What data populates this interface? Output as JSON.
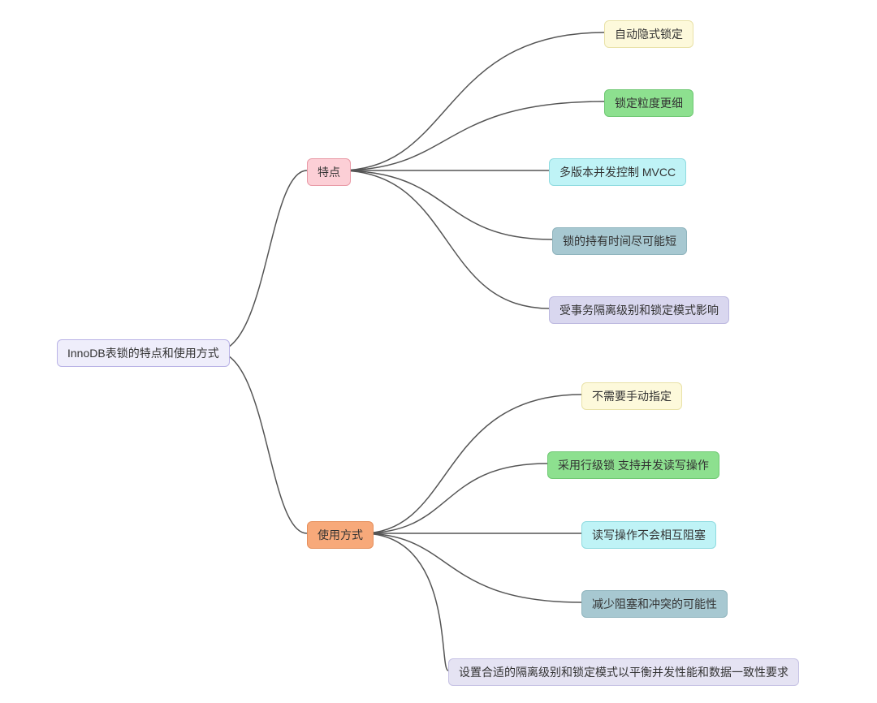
{
  "root": {
    "label": "InnoDB表锁的特点和使用方式"
  },
  "branches": [
    {
      "key": "features",
      "label": "特点",
      "leaves": [
        {
          "label": "自动隐式锁定"
        },
        {
          "label": "锁定粒度更细"
        },
        {
          "label": "多版本并发控制 MVCC"
        },
        {
          "label": "锁的持有时间尽可能短"
        },
        {
          "label": "受事务隔离级别和锁定模式影响"
        }
      ]
    },
    {
      "key": "usage",
      "label": "使用方式",
      "leaves": [
        {
          "label": "不需要手动指定"
        },
        {
          "label": "采用行级锁 支持并发读写操作"
        },
        {
          "label": "读写操作不会相互阻塞"
        },
        {
          "label": "减少阻塞和冲突的可能性"
        },
        {
          "label": "设置合适的隔离级别和锁定模式以平衡并发性能和数据一致性要求"
        }
      ]
    }
  ]
}
